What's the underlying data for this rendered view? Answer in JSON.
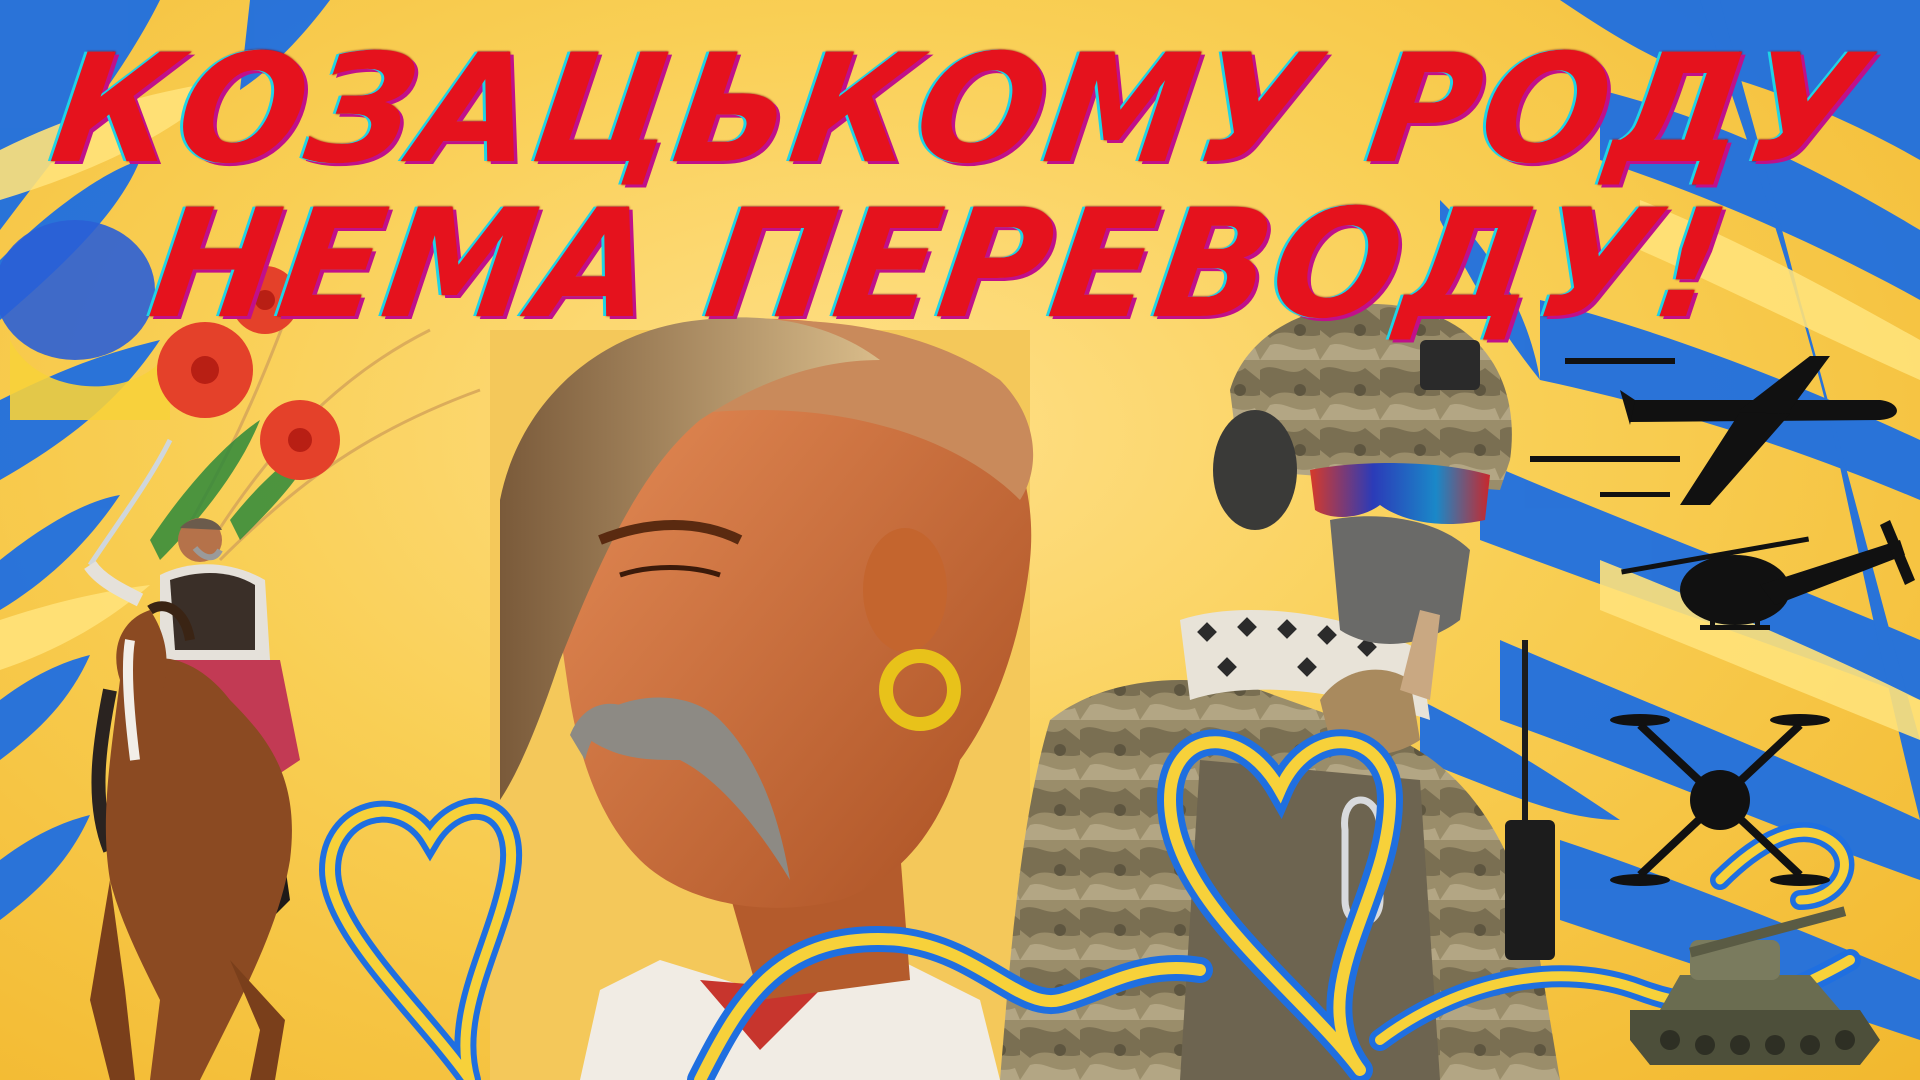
{
  "title": {
    "line1": "КОЗАЦЬКОМУ РОДУ",
    "line2": "НЕМА ПЕРЕВОДУ!"
  },
  "colors": {
    "blue": "#1f6fe0",
    "yellow": "#f9cf55",
    "title_red": "#e5121d",
    "outline_cyan": "#1fd3e6",
    "outline_magenta": "#c0108a"
  },
  "illustrations": {
    "cossack_portrait": "cossack-portrait",
    "soldier": "soldier-figure",
    "rider": "horse-rider",
    "poppies": "poppy-flowers",
    "aircraft": "airplane-icon",
    "helicopter": "helicopter-icon",
    "drone": "drone-icon",
    "tank": "tank-icon",
    "ribbon_hearts": "ribbon-heart"
  }
}
